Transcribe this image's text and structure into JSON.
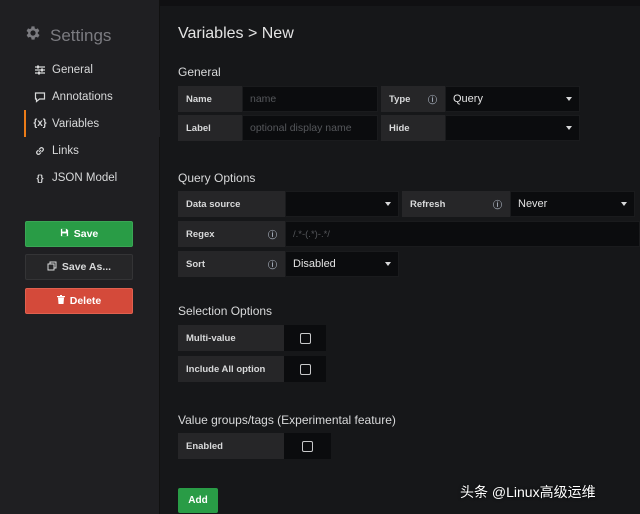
{
  "sidebar": {
    "title": "Settings",
    "items": [
      {
        "label": "General",
        "icon": "sliders-icon"
      },
      {
        "label": "Annotations",
        "icon": "comment-icon"
      },
      {
        "label": "Variables",
        "icon": "braces-icon"
      },
      {
        "label": "Links",
        "icon": "link-icon"
      },
      {
        "label": "JSON Model",
        "icon": "code-file-icon"
      }
    ],
    "save_label": "Save",
    "save_as_label": "Save As...",
    "delete_label": "Delete"
  },
  "page": {
    "title": "Variables > New"
  },
  "general": {
    "title": "General",
    "name_label": "Name",
    "name_placeholder": "name",
    "type_label": "Type",
    "type_value": "Query",
    "label_label": "Label",
    "label_placeholder": "optional display name",
    "hide_label": "Hide",
    "hide_value": ""
  },
  "query_options": {
    "title": "Query Options",
    "datasource_label": "Data source",
    "datasource_value": "",
    "refresh_label": "Refresh",
    "refresh_value": "Never",
    "regex_label": "Regex",
    "regex_placeholder": "/.*-(.*)-.*/",
    "sort_label": "Sort",
    "sort_value": "Disabled"
  },
  "selection_options": {
    "title": "Selection Options",
    "multi_value_label": "Multi-value",
    "multi_value_checked": false,
    "include_all_label": "Include All option",
    "include_all_checked": false
  },
  "value_groups": {
    "title": "Value groups/tags (Experimental feature)",
    "enabled_label": "Enabled",
    "enabled_checked": false
  },
  "add_label": "Add",
  "watermark": "头条 @Linux高级运维"
}
